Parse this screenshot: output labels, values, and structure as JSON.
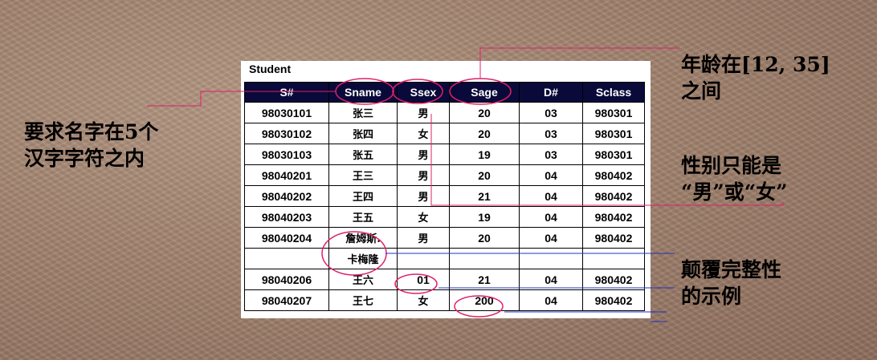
{
  "table": {
    "title": "Student",
    "headers": [
      "S#",
      "Sname",
      "Ssex",
      "Sage",
      "D#",
      "Sclass"
    ],
    "rows": [
      [
        "98030101",
        "张三",
        "男",
        "20",
        "03",
        "980301"
      ],
      [
        "98030102",
        "张四",
        "女",
        "20",
        "03",
        "980301"
      ],
      [
        "98030103",
        "张五",
        "男",
        "19",
        "03",
        "980301"
      ],
      [
        "98040201",
        "王三",
        "男",
        "20",
        "04",
        "980402"
      ],
      [
        "98040202",
        "王四",
        "男",
        "21",
        "04",
        "980402"
      ],
      [
        "98040203",
        "王五",
        "女",
        "19",
        "04",
        "980402"
      ],
      [
        "98040204",
        "詹姆斯.",
        "男",
        "20",
        "04",
        "980402"
      ],
      [
        "",
        "卡梅隆",
        "",
        "",
        "",
        ""
      ],
      [
        "98040206",
        "王六",
        "01",
        "21",
        "04",
        "980402"
      ],
      [
        "98040207",
        "王七",
        "女",
        "200",
        "04",
        "980402"
      ]
    ]
  },
  "annotations": {
    "name_rule": [
      "要求名字在5个",
      "汉字字符之内"
    ],
    "age_rule": [
      "年龄在[12, 35]",
      "之间"
    ],
    "sex_rule": [
      "性别只能是",
      "“男”或“女”"
    ],
    "violation_note": [
      "颠覆完整性",
      "的示例"
    ]
  },
  "colors": {
    "header_bg": "#0a0a3a",
    "highlight_circle": "#e0206a",
    "connector_line": "#2030c0"
  }
}
